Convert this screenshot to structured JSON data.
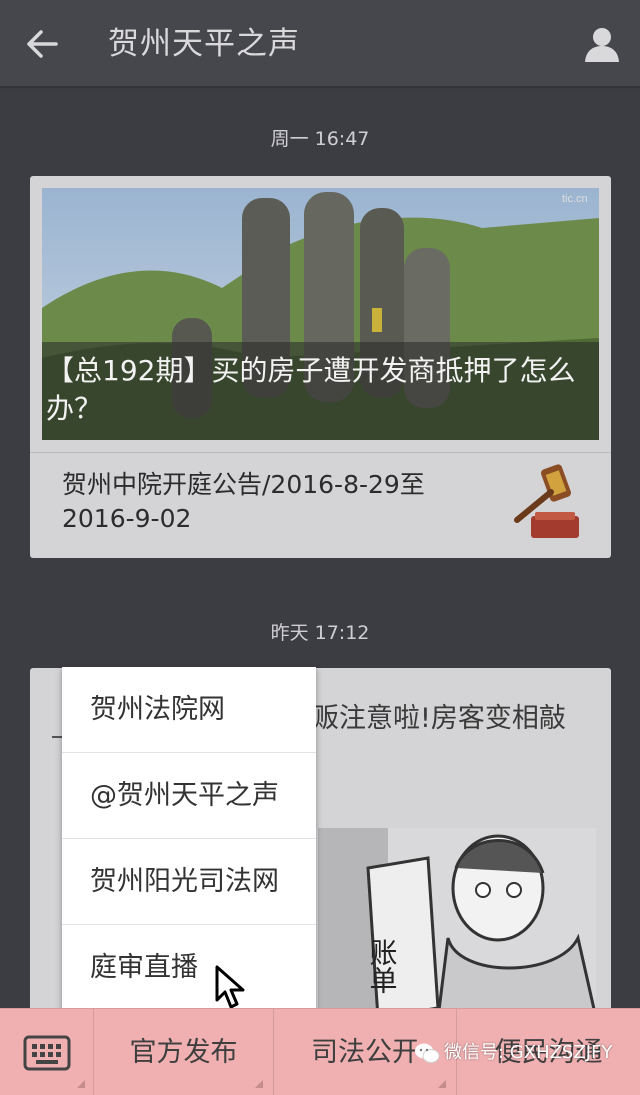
{
  "header": {
    "title": "贺州天平之声",
    "back_icon": "arrow-left-icon",
    "profile_icon": "person-icon"
  },
  "messages": [
    {
      "timestamp": "周一 16:47",
      "cover_caption": "【总192期】买的房子遭开发商抵押了怎么办？",
      "sub_item": "贺州中院开庭公告/2016-8-29至2016-9-02",
      "thumb_icon": "gavel-icon"
    },
    {
      "timestamp": "昨天 17:12",
      "title_partial": "贩注意啦!房客变相敲",
      "comic_text": "账单"
    }
  ],
  "popup_menu": {
    "items": [
      "贺州法院网",
      "@贺州天平之声",
      "贺州阳光司法网",
      "庭审直播"
    ]
  },
  "bottom_menu": {
    "keyboard_icon": "keyboard-icon",
    "items": [
      "官方发布",
      "司法公开",
      "便民沟通"
    ]
  },
  "watermark": {
    "text": "微信号: GXHZSZJFY"
  },
  "colors": {
    "header_bg": "#46464d",
    "chat_bg": "#3c3c43",
    "card_bg": "#d4d4d6",
    "bottom_bar_bg": "#f0b0b1"
  }
}
